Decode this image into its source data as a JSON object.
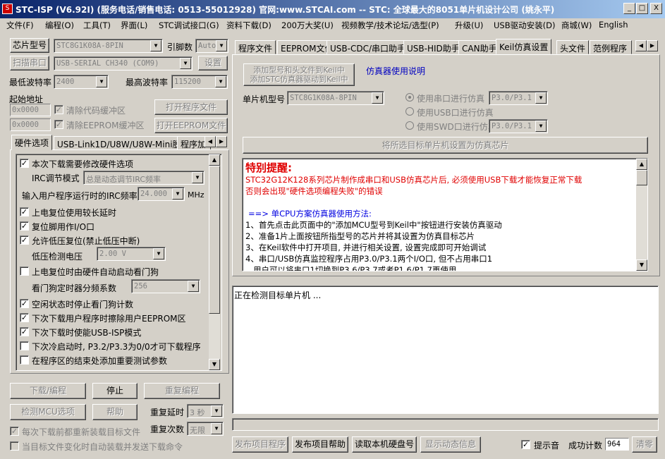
{
  "window": {
    "title": "STC-ISP (V6.92I) (服务电话/销售电话: 0513-55012928) 官网:www.STCAI.com  -- STC: 全球最大的8051单片机设计公司 (姚永平)",
    "controls": [
      "_",
      "□",
      "X"
    ]
  },
  "menu": [
    "文件(F)",
    "编程(O)",
    "工具(T)",
    "界面(L)",
    "STC调试接口(G)",
    "资料下载(D)",
    "200万大奖(U)",
    "视频教学/技术论坛/选型(P)",
    "升级(U)",
    "USB驱动安装(D)",
    "商城(W)",
    "English"
  ],
  "left": {
    "chip_type_button": "芯片型号",
    "chip_type_value": "STC8G1K08A-8PIN",
    "pin_count_label": "引脚数",
    "pin_count_value": "Auto",
    "scan_port_button": "扫描串口",
    "port_value": "USB-SERIAL CH340 (COM9)",
    "settings_button": "设置",
    "min_baud_label": "最低波特率",
    "min_baud_value": "2400",
    "max_baud_label": "最高波特率",
    "max_baud_value": "115200",
    "start_addr_label": "起始地址",
    "addr1_value": "0x0000",
    "clear_code_buffer": "清除代码缓冲区",
    "open_program_button": "打开程序文件",
    "addr2_value": "0x0000",
    "clear_eeprom_buffer": "清除EEPROM缓冲区",
    "open_eeprom_button": "打开EEPROM文件",
    "tabs": [
      "硬件选项",
      "USB-Link1D/U8W/U8W-Mini脱机",
      "程序加"
    ],
    "hw_options": {
      "modify_hw_options": "本次下载需要修改硬件选项",
      "irc_mode_label": "IRC调节模式",
      "irc_mode_value": "总是动态调节IRC频率",
      "irc_freq_label": "输入用户程序运行时的IRC频率",
      "irc_freq_value": "24.000",
      "irc_freq_unit": "MHz",
      "long_delay": "上电复位使用较长延时",
      "reset_pin_io": "复位脚用作I/O口",
      "lvd_reset": "允许低压复位(禁止低压中断)",
      "lvd_voltage_label": "低压检测电压",
      "lvd_voltage_value": "2.00 V",
      "wdt_autostart": "上电复位时由硬件自动启动看门狗",
      "wdt_prescale_label": "看门狗定时器分频系数",
      "wdt_prescale_value": "256",
      "idle_stop_wdt": "空闲状态时停止看门狗计数",
      "erase_eeprom": "下次下载用户程序时擦除用户EEPROM区",
      "usb_isp_mode": "下次下载时使能USB-ISP模式",
      "p32_p33": "下次冷启动时, P3.2/P3.3为0/0才可下载程序",
      "add_test_params": "在程序区的结束处添加重要测试参数"
    },
    "download_button": "下载/编程",
    "stop_button": "停止",
    "reprogram_button": "重复编程",
    "check_mcu_button": "检测MCU选项",
    "help_button": "帮助",
    "repeat_delay_label": "重复延时",
    "repeat_delay_value": "3 秒",
    "repeat_count_label": "重复次数",
    "repeat_count_value": "无限",
    "reload_before_download": "每次下载前都重新装载目标文件",
    "auto_load_on_change": "当目标文件变化时自动装载并发送下载命令"
  },
  "right": {
    "tabs": [
      "程序文件",
      "EEPROM文件",
      "USB-CDC/串口助手",
      "USB-HID助手",
      "CAN助手",
      "Keil仿真设置",
      "头文件",
      "范例程序"
    ],
    "active_tab": "Keil仿真设置",
    "add_to_keil_line1": "添加型号和头文件到Keil中",
    "add_to_keil_line2": "添加STC仿真器驱动到Keil中",
    "emulator_help_link": "仿真器使用说明",
    "mcu_type_label": "单片机型号",
    "mcu_type_value": "STC8G1K08A-8PIN",
    "use_serial_label": "使用串口进行仿真",
    "use_serial_value": "P3.0/P3.1",
    "use_usb_label": "使用USB口进行仿真",
    "use_swd_label": "使用SWD口进行仿真",
    "use_swd_value": "P3.0/P3.1",
    "set_emulator_button": "将所选目标单片机设置为仿真芯片",
    "notice": {
      "title": "特别提醒:",
      "red_line1": "STC32G12K128系列芯片制作成串口和USB仿真芯片后, 必须使用USB下载才能恢复正常下载",
      "red_line2": "否则会出现\"硬件选项编程失败\"的错误",
      "blue_heading": "==> 单CPU方案仿真器使用方法:",
      "steps": [
        "1、首先点击此页面中的\"添加MCU型号到Keil中\"按钮进行安装仿真驱动",
        "2、准备1片上面按钮所指型号的芯片并将其设置为仿真目标芯片",
        "3、在Keil软件中打开项目, 并进行相关设置, 设置完成即可开始调试",
        "4、串口/USB仿真监控程序占用P3.0/P3.1两个I/O口, 但不占用串口1",
        "   用户可以将串口1切换到P3.6/P3.7或者P1.6/P1.7再使用"
      ]
    },
    "log_text": "正在检测目标单片机 ...",
    "publish_project_button": "发布项目程序",
    "publish_help_button": "发布项目帮助",
    "read_disk_button": "读取本机硬盘号",
    "show_dynamic_button": "显示动态信息",
    "beep_label": "提示音",
    "success_count_label": "成功计数",
    "success_count_value": "964",
    "clear_button": "清零"
  }
}
